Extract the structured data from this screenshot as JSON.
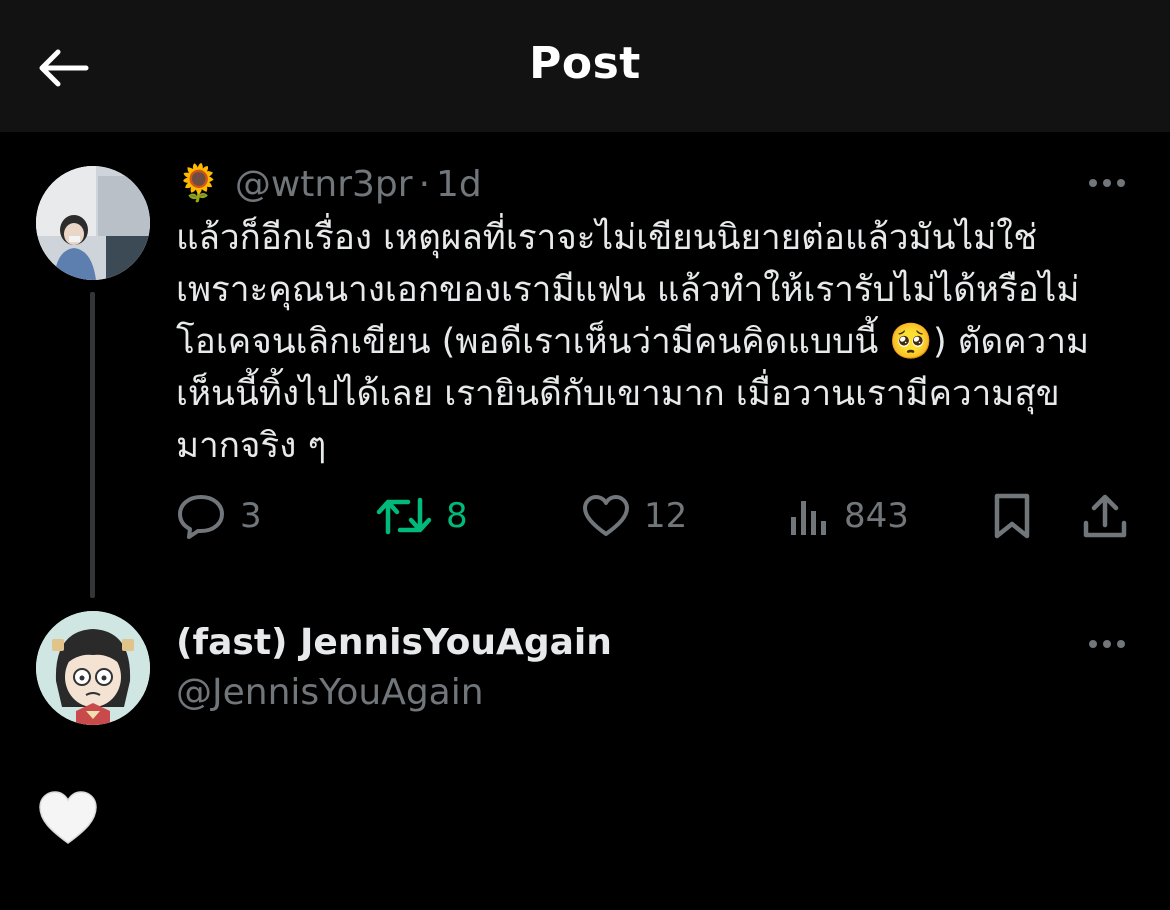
{
  "header": {
    "title": "Post"
  },
  "post": {
    "emoji": "🌻",
    "handle": "@wtnr3pr",
    "time_separator": "·",
    "time": "1d",
    "text": "แล้วก็อีกเรื่อง เหตุผลที่เราจะไม่เขียนนิยายต่อแล้วมันไม่ใช่\nเพราะคุณนางเอกของเรามีแฟน แล้วทำให้เรารับไม่ได้หรือไม่\nโอเคจนเลิกเขียน (พอดีเราเห็นว่ามีคนคิดแบบนี้ 🥺) ตัดความ\nเห็นนี้ทิ้งไปได้เลย เรายินดีกับเขามาก เมื่อวานเรามีความสุข\nมากจริง ๆ",
    "replies": "3",
    "reposts": "8",
    "likes": "12",
    "views": "843"
  },
  "reply": {
    "name": "(fast) JennisYouAgain",
    "handle": "@JennisYouAgain"
  },
  "colors": {
    "background": "#000000",
    "header_bg": "#121212",
    "text": "#e7e9ea",
    "muted": "#71767b",
    "repost_active": "#00ba7c"
  },
  "icons": [
    "back-arrow-icon",
    "more-icon",
    "reply-icon",
    "repost-icon",
    "like-icon",
    "views-icon",
    "bookmark-icon",
    "share-icon",
    "white-heart-icon"
  ]
}
